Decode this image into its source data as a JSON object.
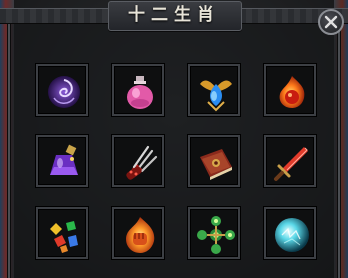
{
  "window": {
    "title": "十二生肖"
  },
  "slots": [
    {
      "icon": "purple-vortex-orb-icon"
    },
    {
      "icon": "pink-potion-bottle-icon"
    },
    {
      "icon": "blue-gem-amulet-icon"
    },
    {
      "icon": "flaming-red-orb-icon"
    },
    {
      "icon": "purple-elixir-bottle-icon"
    },
    {
      "icon": "blood-claw-icon"
    },
    {
      "icon": "red-spellbook-icon"
    },
    {
      "icon": "red-greatsword-icon"
    },
    {
      "icon": "colored-gems-icon"
    },
    {
      "icon": "fire-fist-icon"
    },
    {
      "icon": "green-jade-cross-icon"
    },
    {
      "icon": "cyan-energy-sphere-icon"
    }
  ],
  "colors": {
    "frame": "#3c3f44",
    "title_text": "#e8e4d8",
    "background": "#1a1b1d"
  }
}
